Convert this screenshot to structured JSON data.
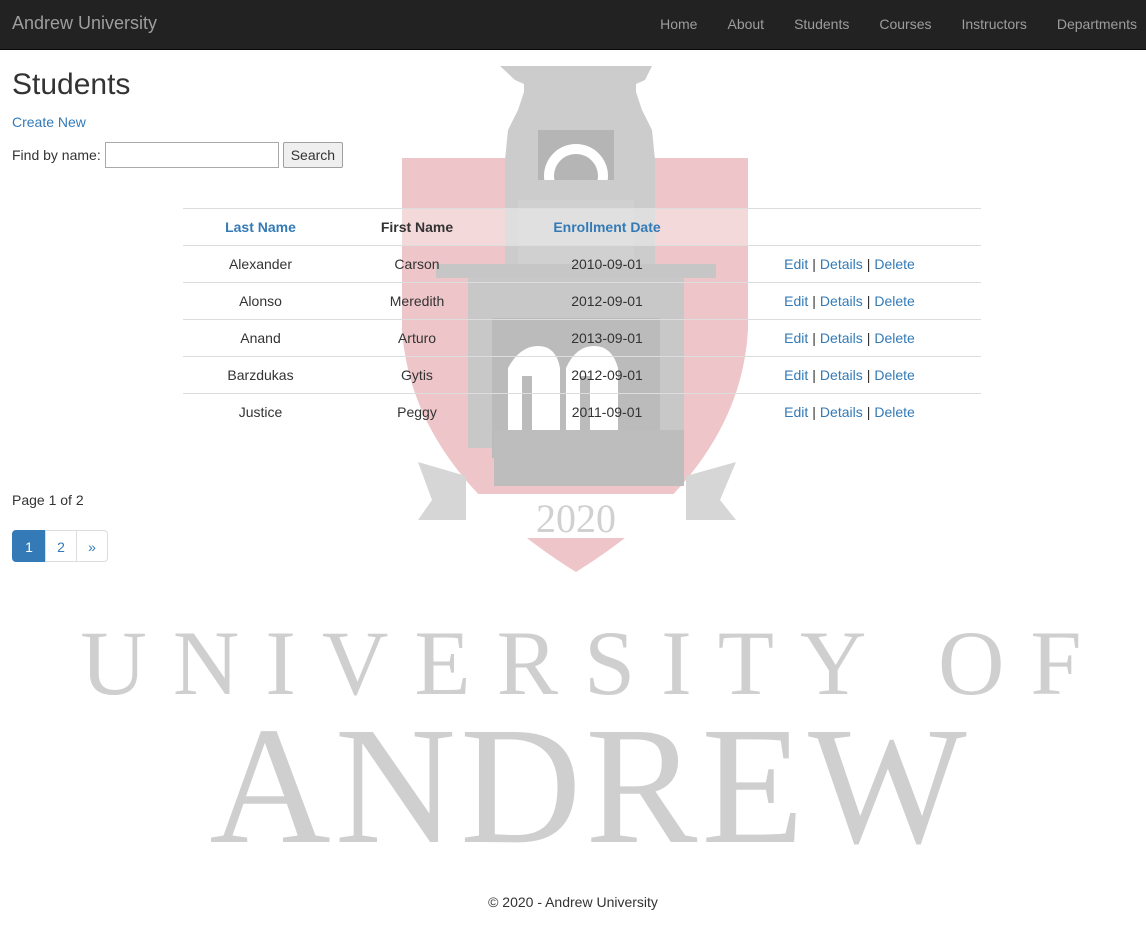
{
  "navbar": {
    "brand": "Andrew University",
    "items": [
      {
        "label": "Home"
      },
      {
        "label": "About"
      },
      {
        "label": "Students"
      },
      {
        "label": "Courses"
      },
      {
        "label": "Instructors"
      },
      {
        "label": "Departments"
      }
    ]
  },
  "page": {
    "title": "Students",
    "create_new": "Create New"
  },
  "search": {
    "label": "Find by name:",
    "value": "",
    "button": "Search"
  },
  "table": {
    "headers": {
      "last_name": "Last Name",
      "first_name": "First Name",
      "enrollment_date": "Enrollment Date"
    },
    "rows": [
      {
        "last_name": "Alexander",
        "first_name": "Carson",
        "enrollment_date": "2010-09-01"
      },
      {
        "last_name": "Alonso",
        "first_name": "Meredith",
        "enrollment_date": "2012-09-01"
      },
      {
        "last_name": "Anand",
        "first_name": "Arturo",
        "enrollment_date": "2013-09-01"
      },
      {
        "last_name": "Barzdukas",
        "first_name": "Gytis",
        "enrollment_date": "2012-09-01"
      },
      {
        "last_name": "Justice",
        "first_name": "Peggy",
        "enrollment_date": "2011-09-01"
      }
    ],
    "actions": {
      "edit": "Edit",
      "details": "Details",
      "delete": "Delete",
      "separator": "|"
    }
  },
  "pagination": {
    "info": "Page 1 of 2",
    "pages": [
      "1",
      "2"
    ],
    "next": "»",
    "current": "1"
  },
  "watermark": {
    "year": "2020",
    "line1": "UNIVERSITY OF",
    "line2": "ANDREW"
  },
  "footer": {
    "text": "© 2020 - Andrew University"
  },
  "colors": {
    "navbar_bg": "#222222",
    "nav_text": "#9d9d9d",
    "link": "#337ab7",
    "active_page": "#337ab7",
    "watermark_grey": "#c8c8c8",
    "watermark_red": "#e8b4b8"
  }
}
